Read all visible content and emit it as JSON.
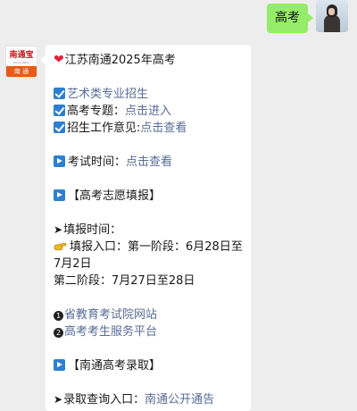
{
  "user_message": {
    "text": "高考"
  },
  "publisher": {
    "logo_top": "南通宝",
    "logo_sub": "NantongBao",
    "logo_bottom": "南 通"
  },
  "message": {
    "title": "江苏南通2025年高考",
    "items": {
      "art": "艺术类专业招生",
      "gaokao_topic_label": "高考专题：",
      "gaokao_topic_link": "点击进入",
      "enroll_opinion_label": "招生工作意见:",
      "enroll_opinion_link": "点击查看",
      "exam_time_label": "考试时间：",
      "exam_time_link": "点击查看",
      "volunteer_header": "【高考志愿填报】",
      "fill_time": "填报时间：",
      "fill_entry": "填报入口：第一阶段：6月28日至7月2日",
      "stage2": "第二阶段：7月27日至28日",
      "link1": "省教育考试院网站",
      "link2": "高考考生服务平台",
      "admission_header": "【南通高考录取】",
      "cutoff_label": "录取查询入口：",
      "cutoff_link": "南通公开通告"
    },
    "num1": "1",
    "num2": "2"
  },
  "colors": {
    "link": "#576b95",
    "green_bubble": "#95ec69",
    "background": "#ededed"
  }
}
